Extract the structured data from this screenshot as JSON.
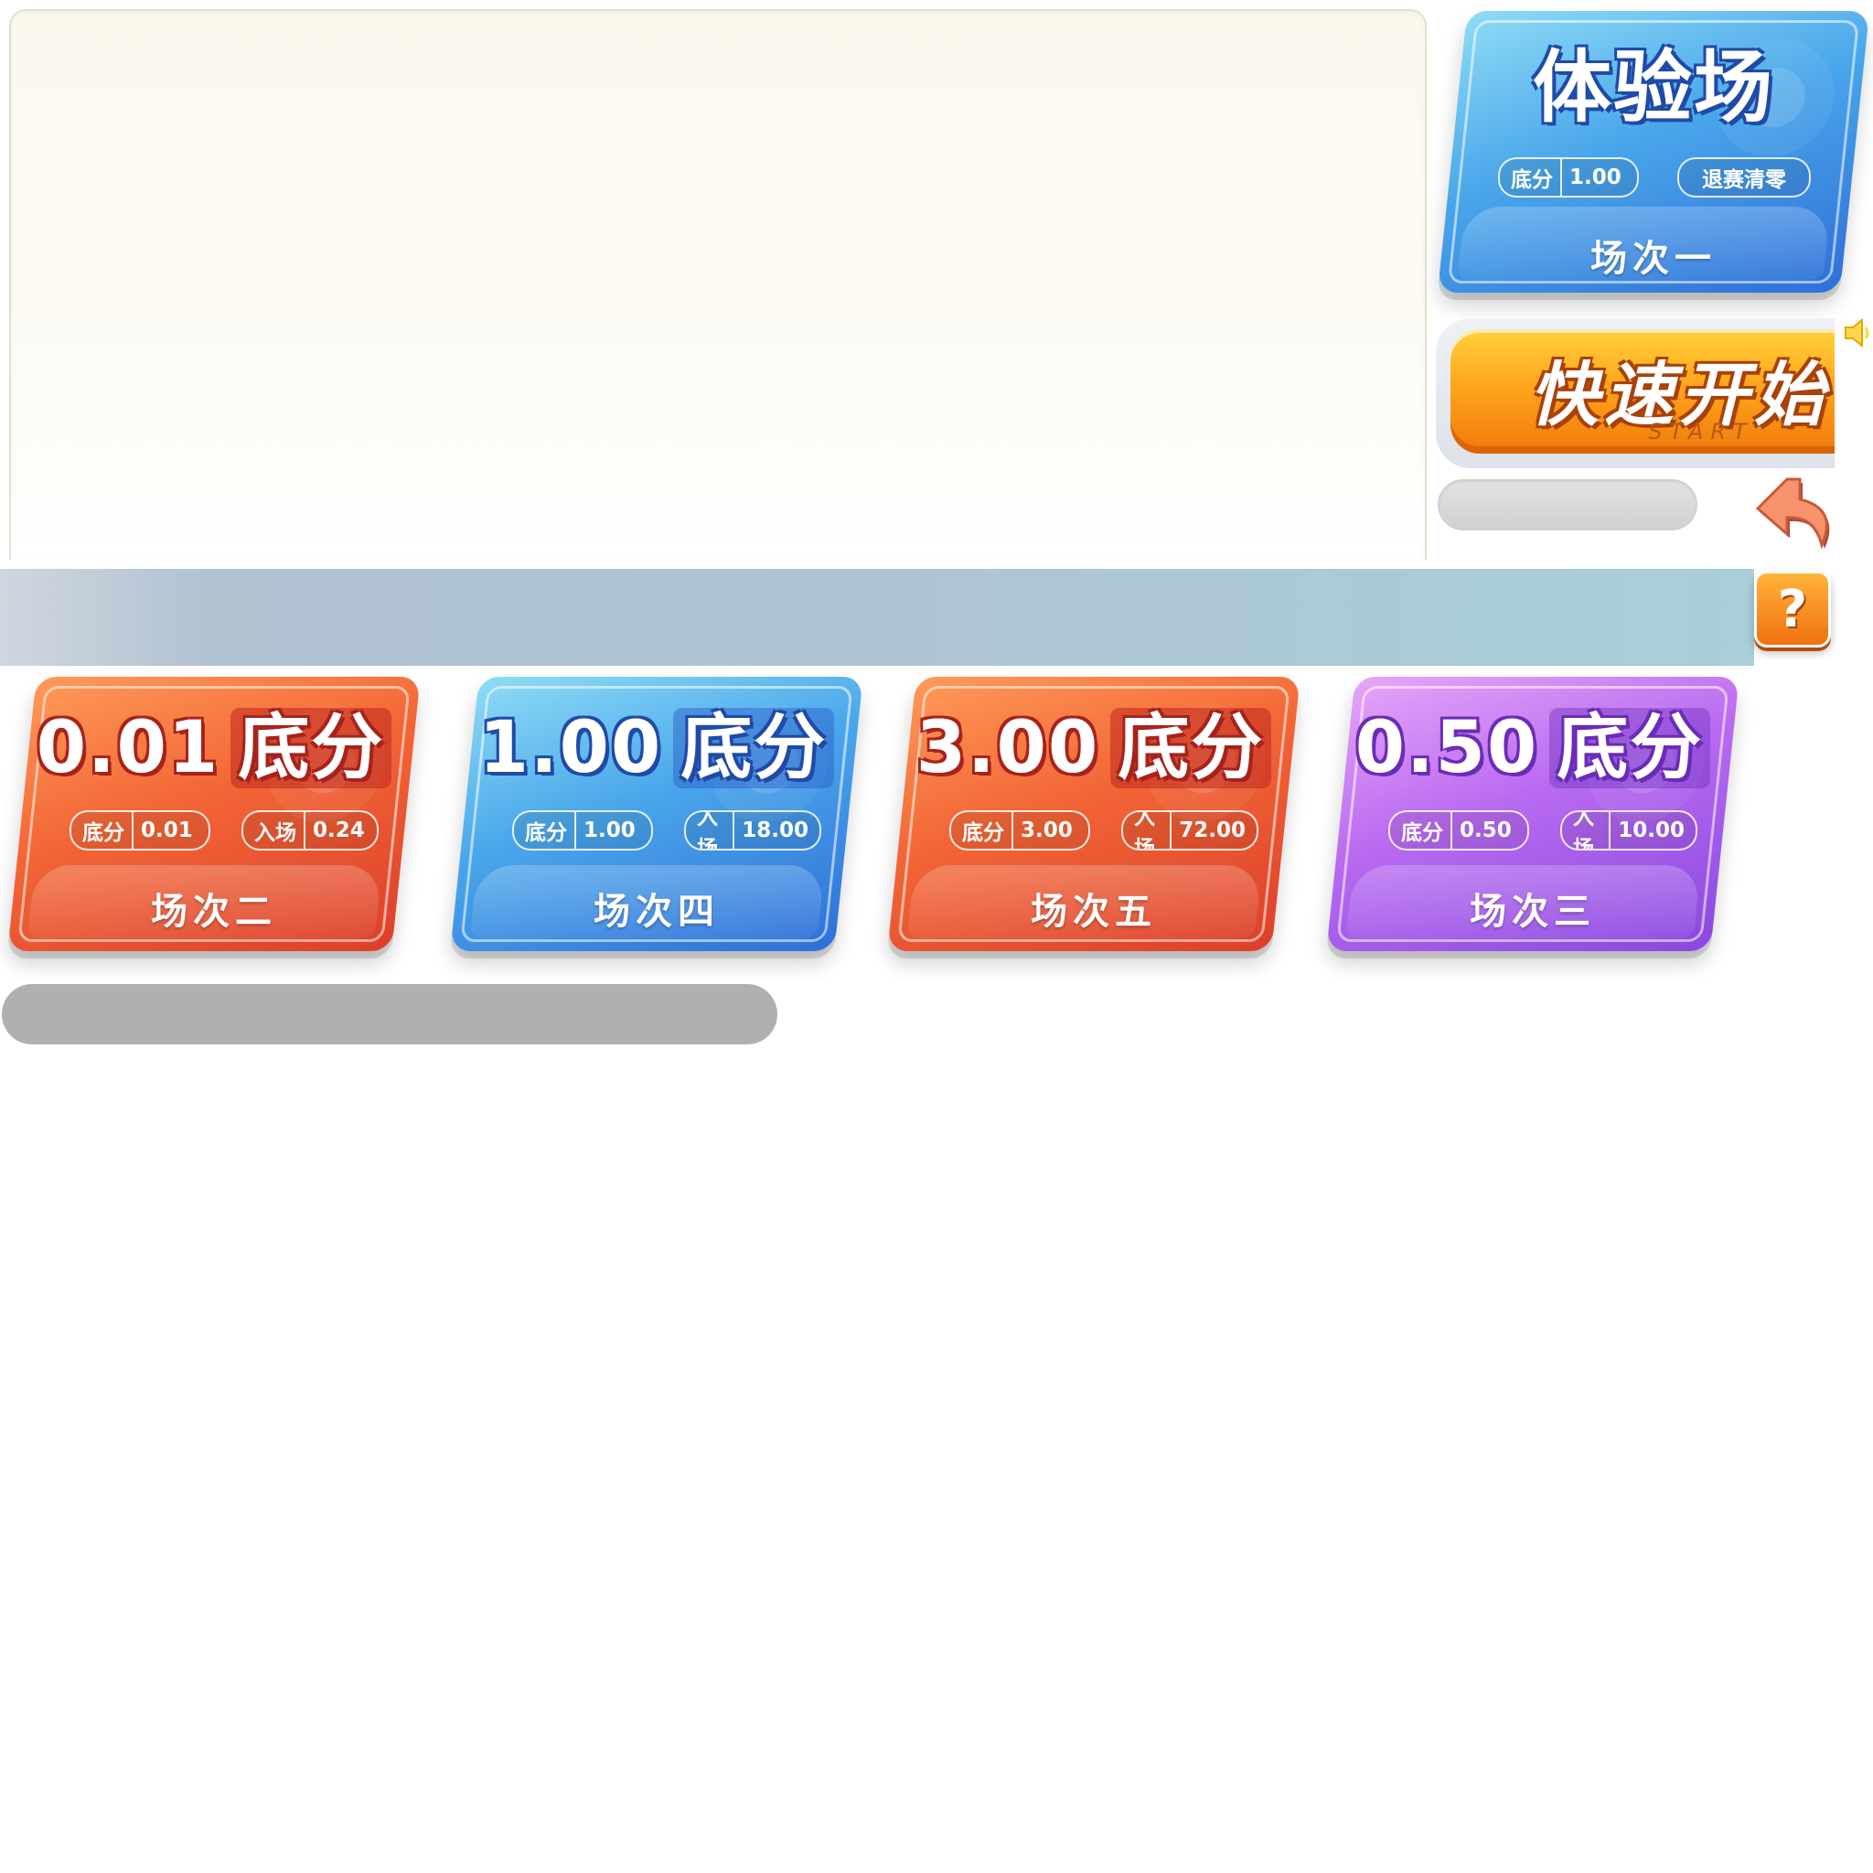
{
  "trial_room": {
    "title": "体验场",
    "base_label": "底分",
    "base_value": "1.00",
    "reset_note": "退赛清零",
    "room_name": "场次一"
  },
  "quick_start": {
    "label": "快速开始",
    "sub_label": "START"
  },
  "help": {
    "label": "?"
  },
  "rooms": [
    {
      "amount": "0.01",
      "word": "底分",
      "base_label": "底分",
      "base_value": "0.01",
      "entry_label": "入场",
      "entry_value": "0.24",
      "room_name": "场次二",
      "theme": "red"
    },
    {
      "amount": "1.00",
      "word": "底分",
      "base_label": "底分",
      "base_value": "1.00",
      "entry_label": "入场",
      "entry_value": "18.00",
      "room_name": "场次四",
      "theme": "blue"
    },
    {
      "amount": "3.00",
      "word": "底分",
      "base_label": "底分",
      "base_value": "3.00",
      "entry_label": "入场",
      "entry_value": "72.00",
      "room_name": "场次五",
      "theme": "red"
    },
    {
      "amount": "0.50",
      "word": "底分",
      "base_label": "底分",
      "base_value": "0.50",
      "entry_label": "入场",
      "entry_value": "10.00",
      "room_name": "场次三",
      "theme": "purple"
    }
  ],
  "icons": {
    "back": "back-arrow-icon",
    "speaker": "speaker-icon",
    "help": "question-mark-icon"
  },
  "colors": {
    "red_card": "#f26536",
    "blue_card": "#49a6ea",
    "purple_card": "#b86af0",
    "quick_start": "#ffa51c"
  }
}
